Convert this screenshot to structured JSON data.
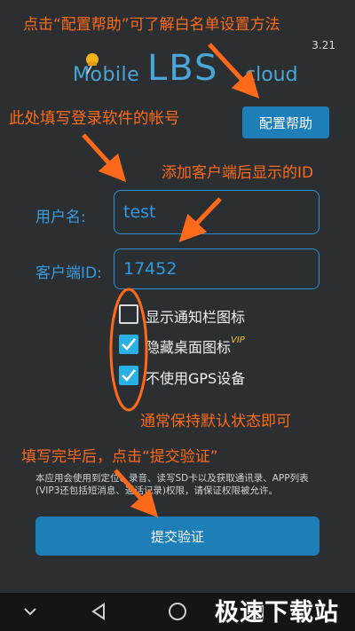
{
  "app": {
    "version": "3.21",
    "logo": {
      "mobile": "Mobile",
      "lbs": "LBS",
      "cloud": "cloud"
    },
    "help_button": "配置帮助",
    "username_label": "用户名:",
    "username_value": "test",
    "client_id_label": "客户端ID:",
    "client_id_value": "17452",
    "options": [
      {
        "label": "显示通知栏图标",
        "checked": false
      },
      {
        "label": "隐藏桌面图标",
        "badge": "VIP",
        "checked": true
      },
      {
        "label": "不使用GPS设备",
        "checked": true
      }
    ],
    "notice": "本应用会使用到定位、录音、读写SD卡以及获取通讯录、APP列表(VIP3还包括短消息、通话记录)权限，请保证权限被允许。",
    "submit_button": "提交验证"
  },
  "annotations": {
    "top": "点击“配置帮助”可了解白名单设置方法",
    "account": "此处填写登录软件的帐号",
    "client_id": "添加客户端后显示的ID",
    "defaults": "通常保持默认状态即可",
    "submit": "填写完毕后，点击“提交验证”"
  },
  "watermark": "极速下载站",
  "colors": {
    "accent": "#1e7fb8",
    "annotation": "#ff6a1a",
    "background": "#2b2f31"
  }
}
